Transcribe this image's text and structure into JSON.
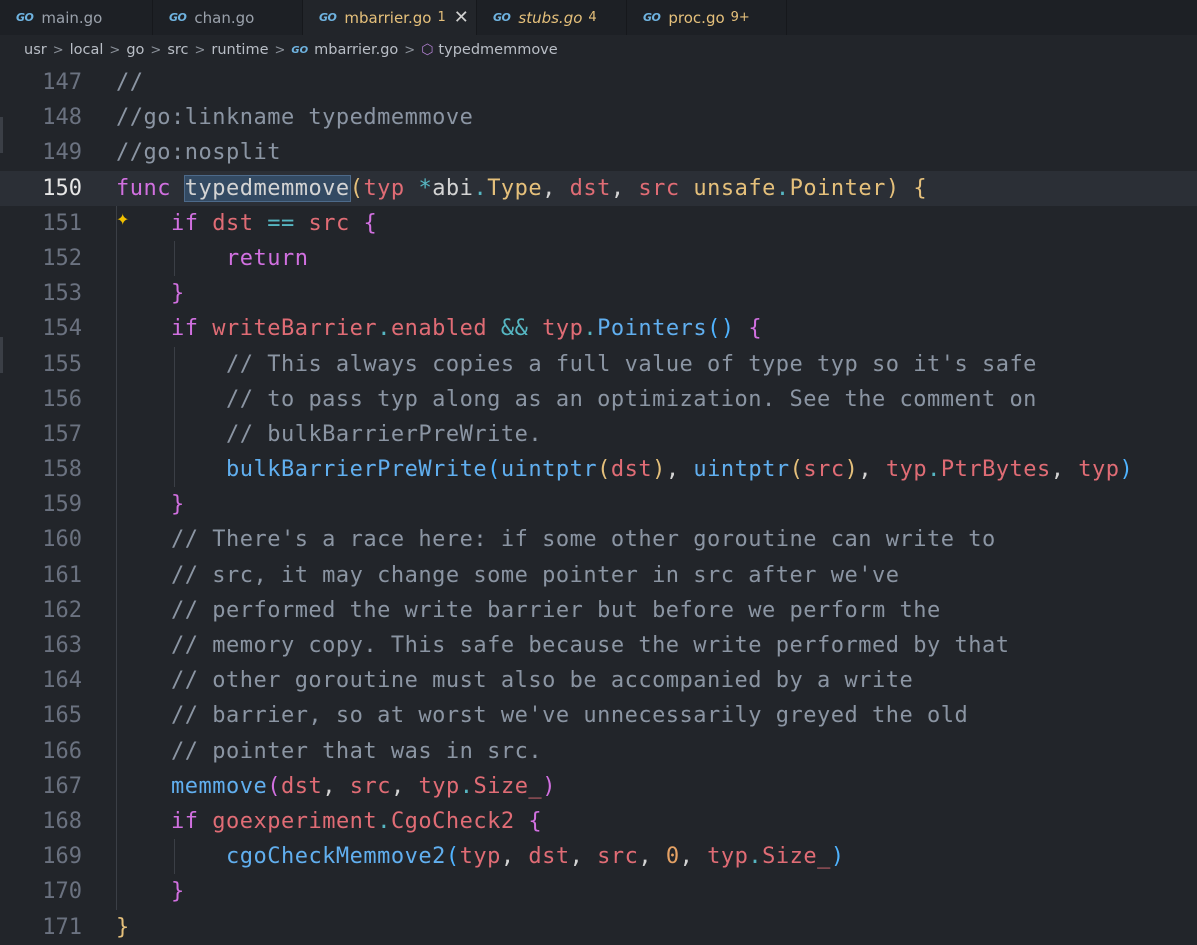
{
  "tabs": [
    {
      "name": "main.go",
      "badge": "",
      "active": false
    },
    {
      "name": "chan.go",
      "badge": "",
      "active": false
    },
    {
      "name": "mbarrier.go",
      "badge": "1",
      "active": true
    },
    {
      "name": "stubs.go",
      "badge": "4",
      "active": false
    },
    {
      "name": "proc.go",
      "badge": "9+",
      "active": false
    }
  ],
  "tab_icon_text": "GO",
  "close_glyph": "✕",
  "breadcrumb": {
    "parts": [
      "usr",
      "local",
      "go",
      "src",
      "runtime"
    ],
    "file": "mbarrier.go",
    "symbol": "typedmemmove"
  },
  "editor": {
    "current_line": 150,
    "lines": [
      {
        "n": "147",
        "tokens": [
          [
            "c",
            "//"
          ]
        ]
      },
      {
        "n": "148",
        "tokens": [
          [
            "c",
            "//go:linkname typedmemmove"
          ]
        ]
      },
      {
        "n": "149",
        "tokens": [
          [
            "c",
            "//go:nosplit"
          ]
        ]
      },
      {
        "n": "150",
        "tokens": [
          [
            "kw",
            "func"
          ],
          [
            "pu",
            " "
          ],
          [
            "sel",
            "typedmemmove"
          ],
          [
            "b1",
            "("
          ],
          [
            "pv",
            "typ"
          ],
          [
            "pu",
            " "
          ],
          [
            "op",
            "*"
          ],
          [
            "pu",
            "abi"
          ],
          [
            "op",
            "."
          ],
          [
            "ty",
            "Type"
          ],
          [
            "pu",
            ", "
          ],
          [
            "pv",
            "dst"
          ],
          [
            "pu",
            ", "
          ],
          [
            "pv",
            "src"
          ],
          [
            "pu",
            " "
          ],
          [
            "ty",
            "unsafe"
          ],
          [
            "op",
            "."
          ],
          [
            "ty",
            "Pointer"
          ],
          [
            "b1",
            ")"
          ],
          [
            "pu",
            " "
          ],
          [
            "b1",
            "{"
          ]
        ]
      },
      {
        "n": "151",
        "tokens": [
          [
            "pu",
            "    "
          ],
          [
            "kw",
            "if"
          ],
          [
            "pu",
            " "
          ],
          [
            "pv",
            "dst"
          ],
          [
            "pu",
            " "
          ],
          [
            "op",
            "=="
          ],
          [
            "pu",
            " "
          ],
          [
            "pv",
            "src"
          ],
          [
            "pu",
            " "
          ],
          [
            "b2",
            "{"
          ]
        ]
      },
      {
        "n": "152",
        "tokens": [
          [
            "pu",
            "        "
          ],
          [
            "kw",
            "return"
          ]
        ]
      },
      {
        "n": "153",
        "tokens": [
          [
            "pu",
            "    "
          ],
          [
            "b2",
            "}"
          ]
        ]
      },
      {
        "n": "154",
        "tokens": [
          [
            "pu",
            "    "
          ],
          [
            "kw",
            "if"
          ],
          [
            "pu",
            " "
          ],
          [
            "pv",
            "writeBarrier"
          ],
          [
            "op",
            "."
          ],
          [
            "pv",
            "enabled"
          ],
          [
            "pu",
            " "
          ],
          [
            "op",
            "&&"
          ],
          [
            "pu",
            " "
          ],
          [
            "pv",
            "typ"
          ],
          [
            "op",
            "."
          ],
          [
            "fn",
            "Pointers"
          ],
          [
            "b3",
            "()"
          ],
          [
            "pu",
            " "
          ],
          [
            "b2",
            "{"
          ]
        ]
      },
      {
        "n": "155",
        "tokens": [
          [
            "pu",
            "        "
          ],
          [
            "c",
            "// This always copies a full value of type typ so it's safe"
          ]
        ]
      },
      {
        "n": "156",
        "tokens": [
          [
            "pu",
            "        "
          ],
          [
            "c",
            "// to pass typ along as an optimization. See the comment on"
          ]
        ]
      },
      {
        "n": "157",
        "tokens": [
          [
            "pu",
            "        "
          ],
          [
            "c",
            "// bulkBarrierPreWrite."
          ]
        ]
      },
      {
        "n": "158",
        "tokens": [
          [
            "pu",
            "        "
          ],
          [
            "fn",
            "bulkBarrierPreWrite"
          ],
          [
            "b3",
            "("
          ],
          [
            "fn",
            "uintptr"
          ],
          [
            "b1",
            "("
          ],
          [
            "pv",
            "dst"
          ],
          [
            "b1",
            ")"
          ],
          [
            "pu",
            ", "
          ],
          [
            "fn",
            "uintptr"
          ],
          [
            "b1",
            "("
          ],
          [
            "pv",
            "src"
          ],
          [
            "b1",
            ")"
          ],
          [
            "pu",
            ", "
          ],
          [
            "pv",
            "typ"
          ],
          [
            "op",
            "."
          ],
          [
            "pv",
            "PtrBytes"
          ],
          [
            "pu",
            ", "
          ],
          [
            "pv",
            "typ"
          ],
          [
            "b3",
            ")"
          ]
        ]
      },
      {
        "n": "159",
        "tokens": [
          [
            "pu",
            "    "
          ],
          [
            "b2",
            "}"
          ]
        ]
      },
      {
        "n": "160",
        "tokens": [
          [
            "pu",
            "    "
          ],
          [
            "c",
            "// There's a race here: if some other goroutine can write to"
          ]
        ]
      },
      {
        "n": "161",
        "tokens": [
          [
            "pu",
            "    "
          ],
          [
            "c",
            "// src, it may change some pointer in src after we've"
          ]
        ]
      },
      {
        "n": "162",
        "tokens": [
          [
            "pu",
            "    "
          ],
          [
            "c",
            "// performed the write barrier but before we perform the"
          ]
        ]
      },
      {
        "n": "163",
        "tokens": [
          [
            "pu",
            "    "
          ],
          [
            "c",
            "// memory copy. This safe because the write performed by that"
          ]
        ]
      },
      {
        "n": "164",
        "tokens": [
          [
            "pu",
            "    "
          ],
          [
            "c",
            "// other goroutine must also be accompanied by a write"
          ]
        ]
      },
      {
        "n": "165",
        "tokens": [
          [
            "pu",
            "    "
          ],
          [
            "c",
            "// barrier, so at worst we've unnecessarily greyed the old"
          ]
        ]
      },
      {
        "n": "166",
        "tokens": [
          [
            "pu",
            "    "
          ],
          [
            "c",
            "// pointer that was in src."
          ]
        ]
      },
      {
        "n": "167",
        "tokens": [
          [
            "pu",
            "    "
          ],
          [
            "fn",
            "memmove"
          ],
          [
            "b2",
            "("
          ],
          [
            "pv",
            "dst"
          ],
          [
            "pu",
            ", "
          ],
          [
            "pv",
            "src"
          ],
          [
            "pu",
            ", "
          ],
          [
            "pv",
            "typ"
          ],
          [
            "op",
            "."
          ],
          [
            "pv",
            "Size_"
          ],
          [
            "b2",
            ")"
          ]
        ]
      },
      {
        "n": "168",
        "tokens": [
          [
            "pu",
            "    "
          ],
          [
            "kw",
            "if"
          ],
          [
            "pu",
            " "
          ],
          [
            "pv",
            "goexperiment"
          ],
          [
            "op",
            "."
          ],
          [
            "pv",
            "CgoCheck2"
          ],
          [
            "pu",
            " "
          ],
          [
            "b2",
            "{"
          ]
        ]
      },
      {
        "n": "169",
        "tokens": [
          [
            "pu",
            "        "
          ],
          [
            "fn",
            "cgoCheckMemmove2"
          ],
          [
            "b3",
            "("
          ],
          [
            "pv",
            "typ"
          ],
          [
            "pu",
            ", "
          ],
          [
            "pv",
            "dst"
          ],
          [
            "pu",
            ", "
          ],
          [
            "pv",
            "src"
          ],
          [
            "pu",
            ", "
          ],
          [
            "num",
            "0"
          ],
          [
            "pu",
            ", "
          ],
          [
            "pv",
            "typ"
          ],
          [
            "op",
            "."
          ],
          [
            "pv",
            "Size_"
          ],
          [
            "b3",
            ")"
          ]
        ]
      },
      {
        "n": "170",
        "tokens": [
          [
            "pu",
            "    "
          ],
          [
            "b2",
            "}"
          ]
        ]
      },
      {
        "n": "171",
        "tokens": [
          [
            "b1",
            "}"
          ]
        ]
      }
    ]
  }
}
